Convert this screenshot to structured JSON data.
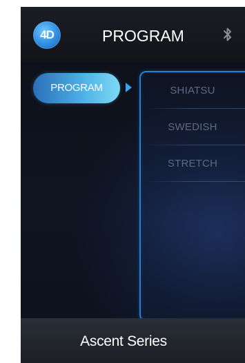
{
  "header": {
    "logo_text": "4D",
    "title": "PROGRAM",
    "bluetooth_icon": "bluetooth-icon"
  },
  "nav": {
    "selected_label": "PROGRAM",
    "indicator_icon": "triangle-right-icon"
  },
  "program_list": {
    "items": [
      {
        "label": "SHIATSU"
      },
      {
        "label": "SWEDISH"
      },
      {
        "label": "STRETCH"
      }
    ]
  },
  "footer": {
    "label": "Ascent Series"
  },
  "colors": {
    "accent": "#4fb4e8",
    "panel_border": "#2a7fd0",
    "item_text": "#5e6a80"
  }
}
